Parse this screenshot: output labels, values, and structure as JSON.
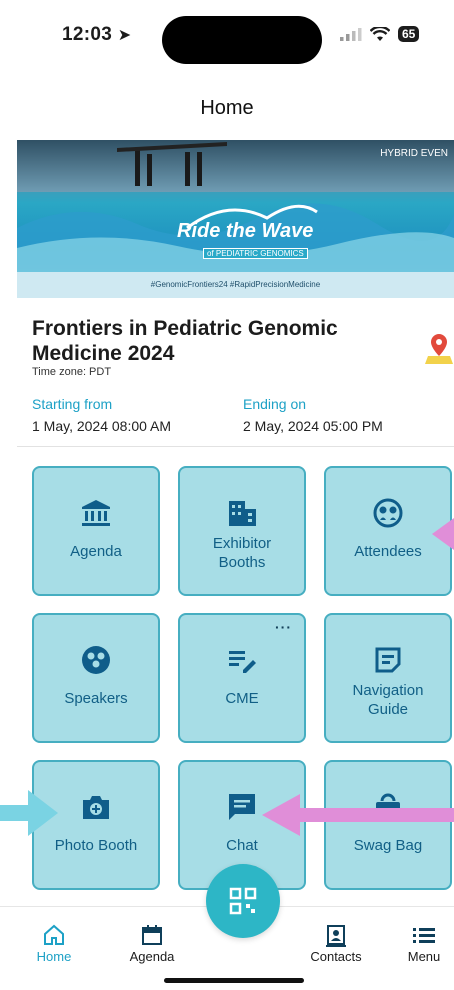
{
  "status_bar": {
    "time": "12:03",
    "battery": "65"
  },
  "header": {
    "title": "Home"
  },
  "banner": {
    "hybrid_label": "HYBRID EVEN",
    "title": "Ride the Wave",
    "subtitle": "of PEDIATRIC GENOMICS",
    "hashtags": "#GenomicFrontiers24   #RapidPrecisionMedicine"
  },
  "event": {
    "title": "Frontiers in Pediatric Genomic Medicine 2024",
    "timezone": "Time zone: PDT",
    "start_label": "Starting from",
    "start_value": "1 May, 2024   08:00 AM",
    "end_label": "Ending on",
    "end_value": "2 May, 2024   05:00 PM"
  },
  "tiles": [
    {
      "label": "Agenda",
      "icon": "building-columns-icon"
    },
    {
      "label": "Exhibitor Booths",
      "icon": "office-building-icon"
    },
    {
      "label": "Attendees",
      "icon": "people-face-icon"
    },
    {
      "label": "Speakers",
      "icon": "group-face-icon"
    },
    {
      "label": "CME",
      "icon": "edit-list-icon",
      "more": "···"
    },
    {
      "label": "Navigation Guide",
      "icon": "document-icon"
    },
    {
      "label": "Photo Booth",
      "icon": "camera-plus-icon"
    },
    {
      "label": "Chat",
      "icon": "chat-bubble-icon"
    },
    {
      "label": "Swag Bag",
      "icon": "bag-icon"
    }
  ],
  "bottom_nav": {
    "home": "Home",
    "agenda": "Agenda",
    "contacts": "Contacts",
    "menu": "Menu"
  },
  "colors": {
    "accent": "#1da1c6",
    "tile_bg": "#a7dde6",
    "tile_border": "#46aec1",
    "tile_text": "#115f86",
    "icon_dark": "#0f5d8a",
    "arrow_pink": "#e08ed8",
    "arrow_cyan": "#7ad3e3"
  }
}
